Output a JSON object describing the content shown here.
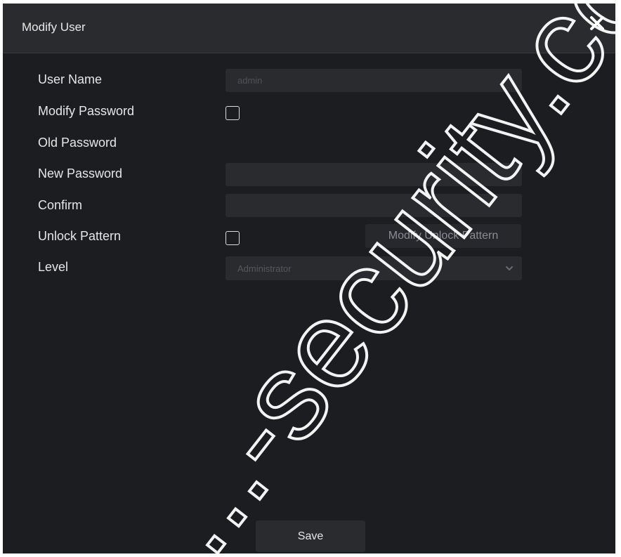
{
  "dialog": {
    "title": "Modify User",
    "close_icon": "close-icon"
  },
  "form": {
    "user_name": {
      "label": "User Name",
      "value": "admin"
    },
    "modify_password": {
      "label": "Modify Password",
      "checked": false
    },
    "old_password": {
      "label": "Old Password"
    },
    "new_password": {
      "label": "New Password",
      "value": ""
    },
    "confirm": {
      "label": "Confirm",
      "value": ""
    },
    "unlock_pattern": {
      "label": "Unlock Pattern",
      "checked": false,
      "button_label": "Modify Unlock Pattern"
    },
    "level": {
      "label": "Level",
      "selected": "Administrator",
      "icon": "chevron-down-icon"
    }
  },
  "footer": {
    "save_label": "Save"
  },
  "watermark": {
    "text": "...-security.co"
  },
  "colors": {
    "dialog_bg": "#1c1d20",
    "titlebar_bg": "#2a2b2f",
    "field_bg": "#2a2b2f",
    "text": "#e6e6e6",
    "muted_text": "#55575c"
  }
}
